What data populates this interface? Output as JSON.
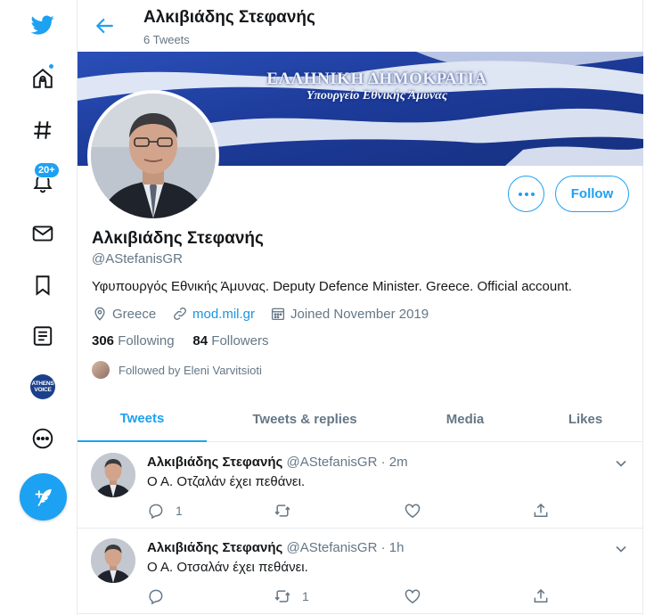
{
  "nav": {
    "notifications_badge": "20+",
    "community_avatar_lines": [
      "ATHENS",
      "VOICE"
    ]
  },
  "header": {
    "name": "Αλκιβιάδης Στεφανής",
    "tweet_count": "6 Tweets"
  },
  "banner": {
    "title": "ΕΛΛΗΝΙΚΗ ΔΗΜΟΚΡΑΤΙΑ",
    "subtitle": "Υπουργείο Εθνικής Άμυνας"
  },
  "profile": {
    "name": "Αλκιβιάδης Στεφανής",
    "handle": "@AStefanisGR",
    "bio": "Υφυπουργός Εθνικής Άμυνας. Deputy Defence Minister. Greece. Official account.",
    "location": "Greece",
    "website": "mod.mil.gr",
    "joined": "Joined November 2019",
    "following_count": "306",
    "following_label": "Following",
    "followers_count": "84",
    "followers_label": "Followers",
    "followed_by": "Followed by Eleni Varvitsioti",
    "follow_label": "Follow"
  },
  "tabs": [
    {
      "label": "Tweets",
      "active": true
    },
    {
      "label": "Tweets & replies",
      "active": false
    },
    {
      "label": "Media",
      "active": false
    },
    {
      "label": "Likes",
      "active": false
    }
  ],
  "tweets": [
    {
      "name": "Αλκιβιάδης Στεφανής",
      "handle_time": "@AStefanisGR · 2m",
      "text": "Ο Α. Οτζαλάν έχει πεθάνει.",
      "replies": "1",
      "retweets": ""
    },
    {
      "name": "Αλκιβιάδης Στεφανής",
      "handle_time": "@AStefanisGR · 1h",
      "text": "Ο Α. Οτσαλάν έχει πεθάνει.",
      "replies": "",
      "retweets": "1"
    }
  ],
  "colors": {
    "accent": "#1da1f2",
    "muted": "#657786",
    "banner_blue": "#1e3c9a"
  }
}
